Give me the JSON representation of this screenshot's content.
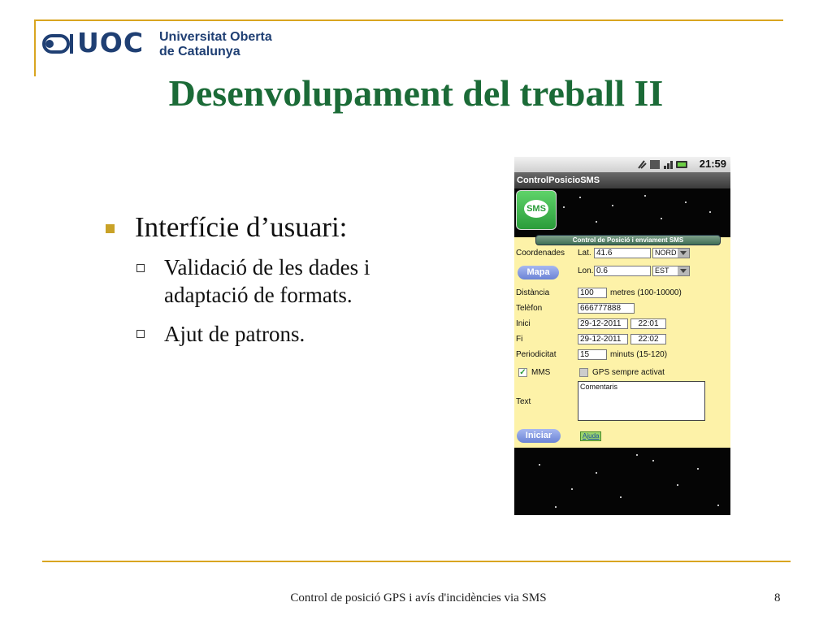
{
  "logo": {
    "acronym": "UOC",
    "name_line1": "Universitat Oberta",
    "name_line2": "de Catalunya"
  },
  "title": "Desenvolupament del treball II",
  "bullets": {
    "main": "Interfície d’usuari:",
    "sub": [
      "Validació de les dades i",
      "adaptació de formats.",
      "Ajut de patrons."
    ]
  },
  "phone": {
    "time": "21:59",
    "app_title": "ControlPosicioSMS",
    "icon_label": "SMS",
    "section_title": "Control de Posició i enviament SMS",
    "coords_label": "Coordenades",
    "lat_label": "Lat.",
    "lat_value": "41.6",
    "lat_dir": "NORD",
    "lon_label": "Lon.",
    "lon_value": "0.6",
    "lon_dir": "EST",
    "map_button": "Mapa",
    "distance_label": "Distància",
    "distance_value": "100",
    "distance_unit": "metres (100-10000)",
    "phone_label": "Telèfon",
    "phone_value": "666777888",
    "start_label": "Inici",
    "start_date": "29-12-2011",
    "start_time": "22:01",
    "end_label": "Fi",
    "end_date": "29-12-2011",
    "end_time": "22:02",
    "period_label": "Periodicitat",
    "period_value": "15",
    "period_unit": "minuts (15-120)",
    "mms_label": "MMS",
    "gps_label": "GPS sempre activat",
    "text_label": "Text",
    "text_value": "Comentaris",
    "start_button": "Iniciar",
    "help_link": "Ajuda"
  },
  "footer": {
    "text": "Control de posició GPS i avís d'incidències via SMS",
    "page": "8"
  }
}
